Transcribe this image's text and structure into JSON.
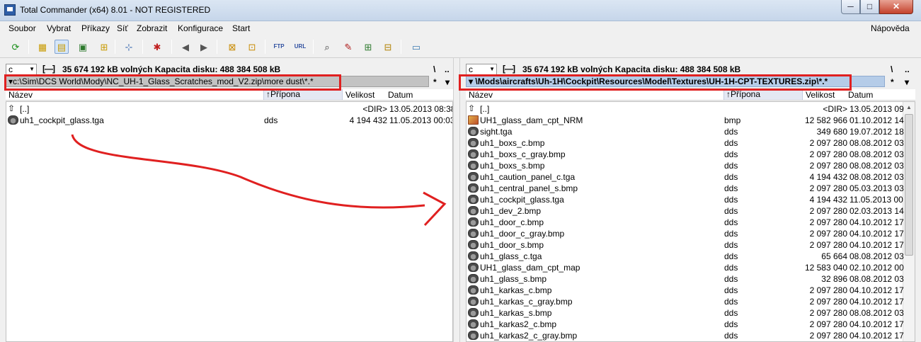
{
  "window": {
    "title": "Total Commander (x64) 8.01 - NOT REGISTERED",
    "min": "─",
    "max": "□",
    "close": "✕"
  },
  "menu": {
    "left": [
      "Soubor",
      "Vybrat",
      "Příkazy",
      "Síť",
      "Zobrazit",
      "Konfigurace",
      "Start"
    ],
    "help": "Nápověda"
  },
  "toolbar": {
    "icons": [
      {
        "name": "refresh-icon",
        "glyph": "⟳",
        "color": "#1a8f1a"
      },
      {
        "name": "brief-view-icon",
        "glyph": "▦",
        "color": "#c89a00"
      },
      {
        "name": "detailed-view-icon",
        "glyph": "▤",
        "color": "#c89a00",
        "active": true
      },
      {
        "name": "thumbnails-icon",
        "glyph": "▣",
        "color": "#2e7a2e"
      },
      {
        "name": "tree-view-icon",
        "glyph": "⊞",
        "color": "#c89a00"
      },
      {
        "name": "invert-selection-icon",
        "glyph": "⊹",
        "color": "#3a6ab0"
      },
      {
        "name": "compare-icon",
        "glyph": "✱",
        "color": "#c02020"
      },
      {
        "name": "back-icon",
        "glyph": "◀",
        "color": "#555"
      },
      {
        "name": "forward-icon",
        "glyph": "▶",
        "color": "#555"
      },
      {
        "name": "pack-icon",
        "glyph": "⊠",
        "color": "#c88a00"
      },
      {
        "name": "unpack-icon",
        "glyph": "⊡",
        "color": "#c88a00"
      },
      {
        "name": "ftp-icon",
        "glyph": "FTP",
        "color": "#3050a0"
      },
      {
        "name": "url-icon",
        "glyph": "URL",
        "color": "#3050a0"
      },
      {
        "name": "search-icon",
        "glyph": "⌕",
        "color": "#333"
      },
      {
        "name": "multi-rename-icon",
        "glyph": "✎",
        "color": "#b02020"
      },
      {
        "name": "sync-dirs-icon",
        "glyph": "⊞",
        "color": "#2e7a2e"
      },
      {
        "name": "lister-icon",
        "glyph": "⊟",
        "color": "#b08000"
      },
      {
        "name": "notepad-icon",
        "glyph": "▭",
        "color": "#3a7ab0"
      }
    ]
  },
  "left": {
    "drive": "c",
    "up_symbol": "[—]",
    "disk_info": "35 674 192 kB volných  Kapacita disku: 488 384 508 kB",
    "root_btn": "\\",
    "parent_btn": "..",
    "path": "▾c:\\Sim\\DCS World\\Mody\\NC_UH-1_Glass_Scratches_mod_V2.zip\\more dust\\*.*",
    "star": "*",
    "history": "▾",
    "columns": {
      "name": "Název",
      "ext": "↑Přípona",
      "size": "Velikost",
      "date": "Datum"
    },
    "rows": [
      {
        "icon": "up",
        "name": "[..]",
        "ext": "",
        "size": "<DIR>",
        "date": "13.05.2013 08:38"
      },
      {
        "icon": "dds",
        "name": "uh1_cockpit_glass.tga",
        "ext": "dds",
        "size": "4 194 432",
        "date": "11.05.2013 00:03"
      }
    ]
  },
  "right": {
    "drive": "c",
    "up_symbol": "[—]",
    "disk_info": "35 674 192 kB volných  Kapacita disku: 488 384 508 kB",
    "root_btn": "\\",
    "parent_btn": "..",
    "path": "▾ \\Mods\\aircrafts\\Uh-1H\\Cockpit\\Resources\\Model\\Textures\\UH-1H-CPT-TEXTURES.zip\\*.*",
    "star": "*",
    "history": "▾",
    "columns": {
      "name": "Název",
      "ext": "↑Přípona",
      "size": "Velikost",
      "date": "Datum"
    },
    "rows": [
      {
        "icon": "up",
        "name": "[..]",
        "ext": "",
        "size": "<DIR>",
        "date": "13.05.2013 09"
      },
      {
        "icon": "bmp",
        "name": "UH1_glass_dam_cpt_NRM",
        "ext": "bmp",
        "size": "12 582 966",
        "date": "01.10.2012 14"
      },
      {
        "icon": "dds",
        "name": "sight.tga",
        "ext": "dds",
        "size": "349 680",
        "date": "19.07.2012 18"
      },
      {
        "icon": "dds",
        "name": "uh1_boxs_c.bmp",
        "ext": "dds",
        "size": "2 097 280",
        "date": "08.08.2012 03"
      },
      {
        "icon": "dds",
        "name": "uh1_boxs_c_gray.bmp",
        "ext": "dds",
        "size": "2 097 280",
        "date": "08.08.2012 03"
      },
      {
        "icon": "dds",
        "name": "uh1_boxs_s.bmp",
        "ext": "dds",
        "size": "2 097 280",
        "date": "08.08.2012 03"
      },
      {
        "icon": "dds",
        "name": "uh1_caution_panel_c.tga",
        "ext": "dds",
        "size": "4 194 432",
        "date": "08.08.2012 03"
      },
      {
        "icon": "dds",
        "name": "uh1_central_panel_s.bmp",
        "ext": "dds",
        "size": "2 097 280",
        "date": "05.03.2013 03"
      },
      {
        "icon": "dds",
        "name": "uh1_cockpit_glass.tga",
        "ext": "dds",
        "size": "4 194 432",
        "date": "11.05.2013 00"
      },
      {
        "icon": "dds",
        "name": "uh1_dev_2.bmp",
        "ext": "dds",
        "size": "2 097 280",
        "date": "02.03.2013 14"
      },
      {
        "icon": "dds",
        "name": "uh1_door_c.bmp",
        "ext": "dds",
        "size": "2 097 280",
        "date": "04.10.2012 17"
      },
      {
        "icon": "dds",
        "name": "uh1_door_c_gray.bmp",
        "ext": "dds",
        "size": "2 097 280",
        "date": "04.10.2012 17"
      },
      {
        "icon": "dds",
        "name": "uh1_door_s.bmp",
        "ext": "dds",
        "size": "2 097 280",
        "date": "04.10.2012 17"
      },
      {
        "icon": "dds",
        "name": "uh1_glass_c.tga",
        "ext": "dds",
        "size": "65 664",
        "date": "08.08.2012 03"
      },
      {
        "icon": "dds",
        "name": "UH1_glass_dam_cpt_map",
        "ext": "dds",
        "size": "12 583 040",
        "date": "02.10.2012 00"
      },
      {
        "icon": "dds",
        "name": "uh1_glass_s.bmp",
        "ext": "dds",
        "size": "32 896",
        "date": "08.08.2012 03"
      },
      {
        "icon": "dds",
        "name": "uh1_karkas_c.bmp",
        "ext": "dds",
        "size": "2 097 280",
        "date": "04.10.2012 17"
      },
      {
        "icon": "dds",
        "name": "uh1_karkas_c_gray.bmp",
        "ext": "dds",
        "size": "2 097 280",
        "date": "04.10.2012 17"
      },
      {
        "icon": "dds",
        "name": "uh1_karkas_s.bmp",
        "ext": "dds",
        "size": "2 097 280",
        "date": "08.08.2012 03"
      },
      {
        "icon": "dds",
        "name": "uh1_karkas2_c.bmp",
        "ext": "dds",
        "size": "2 097 280",
        "date": "04.10.2012 17"
      },
      {
        "icon": "dds",
        "name": "uh1_karkas2_c_gray.bmp",
        "ext": "dds",
        "size": "2 097 280",
        "date": "04.10.2012 17"
      }
    ]
  },
  "colors": {
    "annotation": "#e02020",
    "path_active_bg": "#b5cce8",
    "path_inactive_bg": "#c3c3c3"
  }
}
